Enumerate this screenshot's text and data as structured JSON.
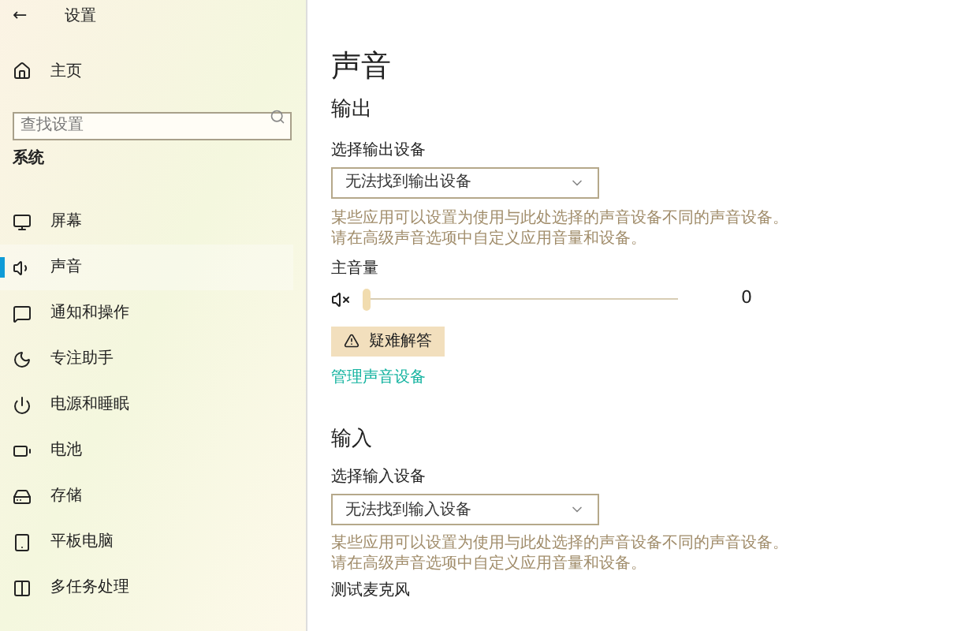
{
  "window": {
    "title": "设置",
    "back": "←"
  },
  "sidebar": {
    "home": "主页",
    "search": {
      "placeholder": "查找设置"
    },
    "section": "系统",
    "items": [
      {
        "label": "屏幕",
        "selected": false
      },
      {
        "label": "声音",
        "selected": true
      },
      {
        "label": "通知和操作",
        "selected": false
      },
      {
        "label": "专注助手",
        "selected": false
      },
      {
        "label": "电源和睡眠",
        "selected": false
      },
      {
        "label": "电池",
        "selected": false
      },
      {
        "label": "存储",
        "selected": false
      },
      {
        "label": "平板电脑",
        "selected": false
      },
      {
        "label": "多任务处理",
        "selected": false
      }
    ]
  },
  "main": {
    "title": "声音",
    "output": {
      "heading": "输出",
      "select_label": "选择输出设备",
      "select_value": "无法找到输出设备",
      "hint": "某些应用可以设置为使用与此处选择的声音设备不同的声音设备。请在高级声音选项中自定义应用音量和设备。",
      "volume_label": "主音量",
      "volume": {
        "level": 0,
        "reading": "0",
        "muted": true
      },
      "troubleshoot": "疑难解答",
      "link": "管理声音设备"
    },
    "input": {
      "heading": "输入",
      "select_label": "选择输入设备",
      "select_value": "无法找到输入设备",
      "hint": "某些应用可以设置为使用与此处选择的声音设备不同的声音设备。请在高级声音选项中自定义应用音量和设备。",
      "test_label": "测试麦克风"
    }
  }
}
